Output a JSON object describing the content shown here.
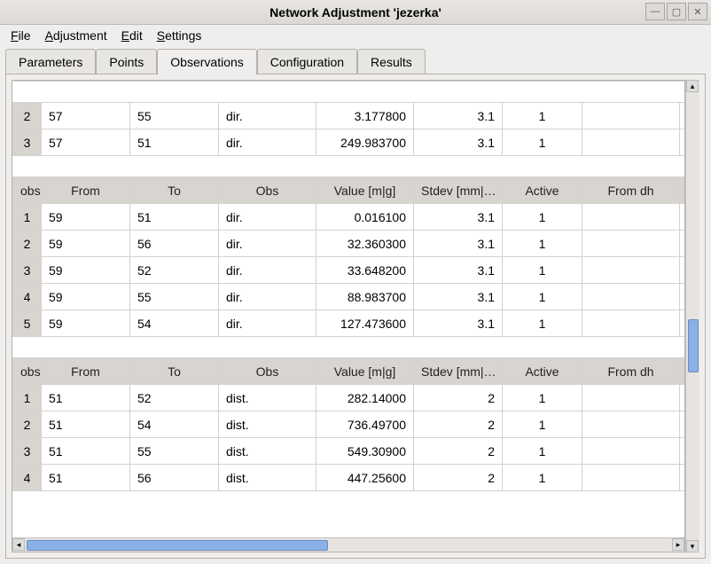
{
  "window": {
    "title": "Network Adjustment 'jezerka'"
  },
  "menu": {
    "file": "File",
    "adjustment": "Adjustment",
    "edit": "Edit",
    "settings": "Settings"
  },
  "tabs": {
    "parameters": "Parameters",
    "points": "Points",
    "observations": "Observations",
    "configuration": "Configuration",
    "results": "Results"
  },
  "headers": {
    "obs": "obs",
    "from": "From",
    "to": "To",
    "obscol": "Obs",
    "value": "Value [m|g]",
    "stdev": "Stdev [mm|…",
    "active": "Active",
    "fromdh": "From dh"
  },
  "group1": [
    {
      "n": "2",
      "from": "57",
      "to": "55",
      "obs": "dir.",
      "value": "3.177800",
      "stdev": "3.1",
      "active": "1",
      "fromdh": ""
    },
    {
      "n": "3",
      "from": "57",
      "to": "51",
      "obs": "dir.",
      "value": "249.983700",
      "stdev": "3.1",
      "active": "1",
      "fromdh": ""
    }
  ],
  "group2": [
    {
      "n": "1",
      "from": "59",
      "to": "51",
      "obs": "dir.",
      "value": "0.016100",
      "stdev": "3.1",
      "active": "1",
      "fromdh": ""
    },
    {
      "n": "2",
      "from": "59",
      "to": "56",
      "obs": "dir.",
      "value": "32.360300",
      "stdev": "3.1",
      "active": "1",
      "fromdh": ""
    },
    {
      "n": "3",
      "from": "59",
      "to": "52",
      "obs": "dir.",
      "value": "33.648200",
      "stdev": "3.1",
      "active": "1",
      "fromdh": ""
    },
    {
      "n": "4",
      "from": "59",
      "to": "55",
      "obs": "dir.",
      "value": "88.983700",
      "stdev": "3.1",
      "active": "1",
      "fromdh": ""
    },
    {
      "n": "5",
      "from": "59",
      "to": "54",
      "obs": "dir.",
      "value": "127.473600",
      "stdev": "3.1",
      "active": "1",
      "fromdh": ""
    }
  ],
  "group3": [
    {
      "n": "1",
      "from": "51",
      "to": "52",
      "obs": "dist.",
      "value": "282.14000",
      "stdev": "2",
      "active": "1",
      "fromdh": ""
    },
    {
      "n": "2",
      "from": "51",
      "to": "54",
      "obs": "dist.",
      "value": "736.49700",
      "stdev": "2",
      "active": "1",
      "fromdh": ""
    },
    {
      "n": "3",
      "from": "51",
      "to": "55",
      "obs": "dist.",
      "value": "549.30900",
      "stdev": "2",
      "active": "1",
      "fromdh": ""
    },
    {
      "n": "4",
      "from": "51",
      "to": "56",
      "obs": "dist.",
      "value": "447.25600",
      "stdev": "2",
      "active": "1",
      "fromdh": ""
    }
  ]
}
